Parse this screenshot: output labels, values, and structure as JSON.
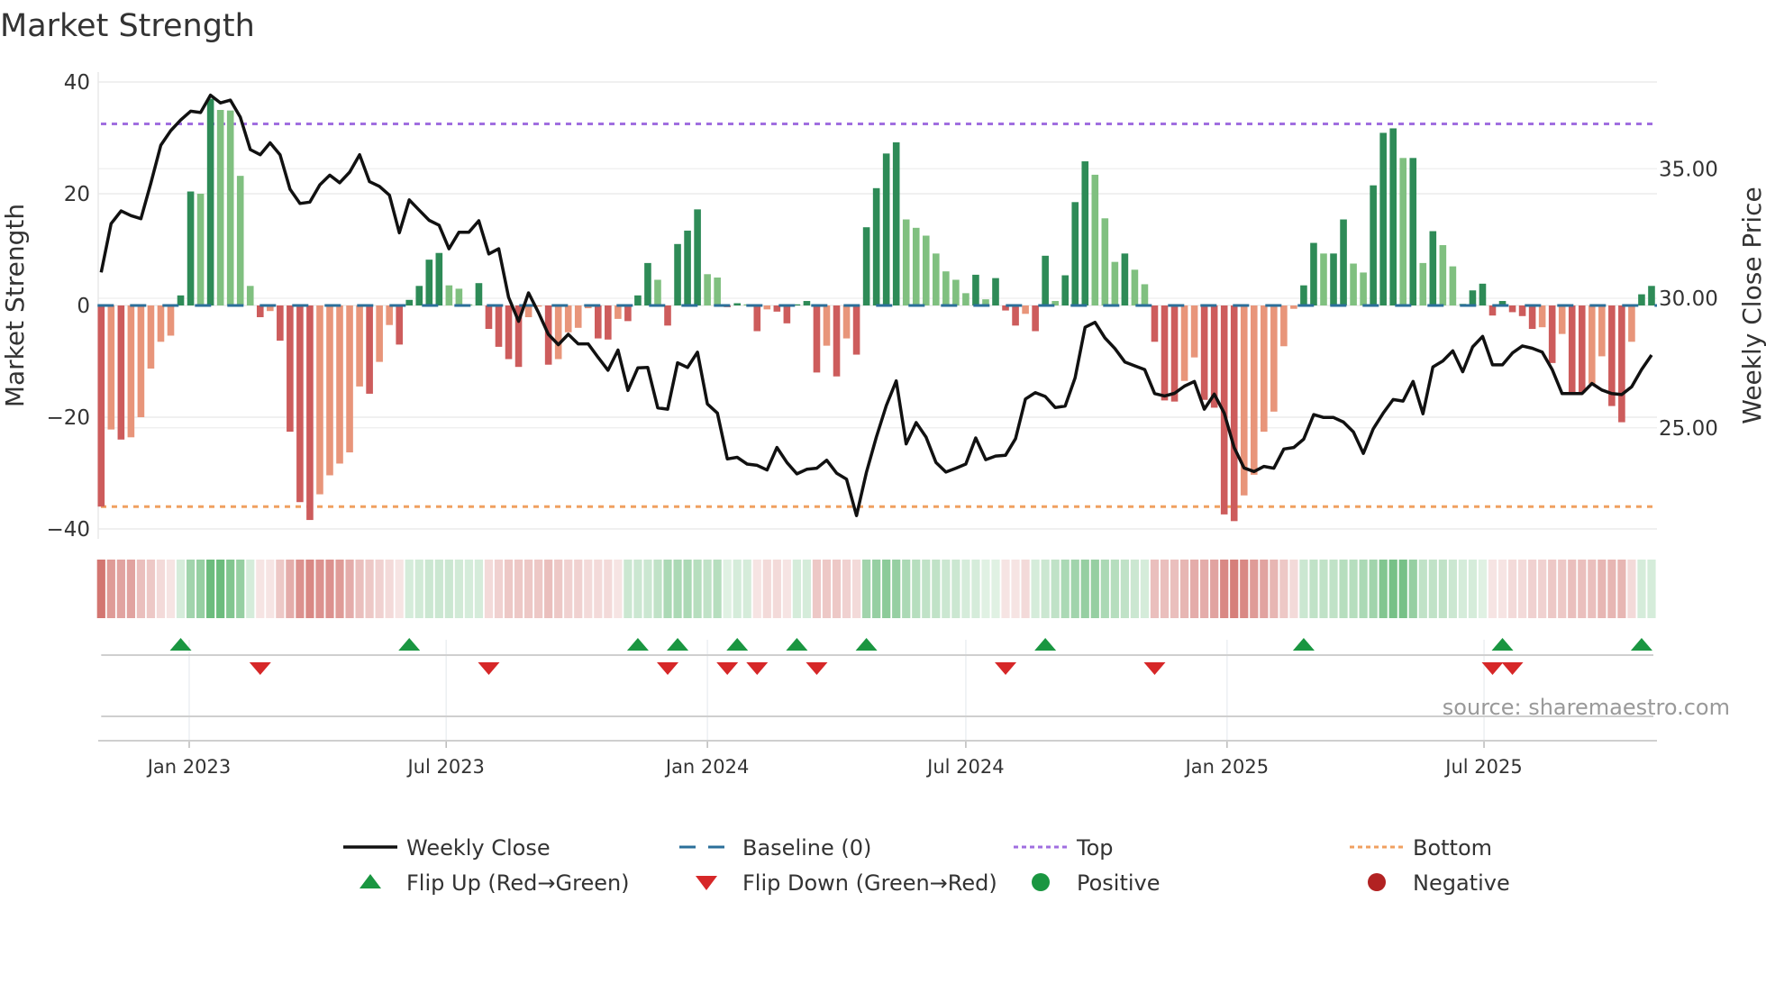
{
  "chart_data": {
    "type": "bar",
    "title": "Market Strength",
    "ylabel": "Market Strength",
    "ylabel_right": "Weekly Close Price",
    "source": "source: sharemaestro.com",
    "ylim": [
      -40,
      40
    ],
    "yticks": [
      {
        "v": 40,
        "label": "40"
      },
      {
        "v": 20,
        "label": "20"
      },
      {
        "v": 0,
        "label": "0"
      },
      {
        "v": -20,
        "label": "−20"
      },
      {
        "v": -40,
        "label": "−40"
      }
    ],
    "ylim_right": [
      21.0,
      38.6
    ],
    "yticks_right": [
      {
        "v": 35,
        "label": "35.00"
      },
      {
        "v": 30,
        "label": "30.00"
      },
      {
        "v": 25,
        "label": "25.00"
      }
    ],
    "x_start_date": "2022-10-31",
    "x_frequency": "weekly",
    "xticks": [
      {
        "date": "2023-01-01",
        "label": "Jan 2023"
      },
      {
        "date": "2023-07-01",
        "label": "Jul 2023"
      },
      {
        "date": "2024-01-01",
        "label": "Jan 2024"
      },
      {
        "date": "2024-07-01",
        "label": "Jul 2024"
      },
      {
        "date": "2025-01-01",
        "label": "Jan 2025"
      },
      {
        "date": "2025-07-01",
        "label": "Jul 2025"
      }
    ],
    "top_level": 32.5,
    "bottom_level": -36,
    "baseline": 0,
    "strength": [
      -36,
      -22.2,
      -24,
      -23.6,
      -20,
      -11.3,
      -6.5,
      -5.4,
      1.8,
      20.4,
      20,
      37,
      35,
      34.9,
      23.2,
      3.5,
      -2.1,
      -1,
      -6.3,
      -22.6,
      -35.2,
      -38.4,
      -33.8,
      -30.4,
      -28.3,
      -26.3,
      -14.5,
      -15.8,
      -10.1,
      -3.5,
      -7,
      1,
      3.5,
      8.2,
      9.4,
      3.6,
      3,
      0.2,
      4,
      -4.2,
      -7.4,
      -9.6,
      -11,
      -2.1,
      -0.2,
      -10.6,
      -9.6,
      -4.8,
      -4,
      -0.5,
      -5.9,
      -6.1,
      -2.4,
      -2.8,
      1.8,
      7.6,
      4.6,
      -3.6,
      11,
      13.4,
      17.2,
      5.6,
      5,
      -0.3,
      0.4,
      0.2,
      -4.6,
      -0.7,
      -1.1,
      -3.2,
      0.2,
      0.8,
      -12,
      -7.2,
      -12.7,
      -5.9,
      -8.8,
      14,
      21,
      27.2,
      29.2,
      15.4,
      13.9,
      12.5,
      9.3,
      6.1,
      4.6,
      2.2,
      5.5,
      1.1,
      4.9,
      -0.9,
      -3.6,
      -1.5,
      -4.6,
      8.9,
      0.8,
      5.4,
      18.5,
      25.8,
      23.4,
      15.6,
      7.8,
      9.3,
      6.4,
      3.8,
      -6.5,
      -17,
      -17.2,
      -13.5,
      -9.3,
      -16.9,
      -18.3,
      -37.4,
      -38.6,
      -34,
      -30.3,
      -22.6,
      -19,
      -7.3,
      -0.6,
      3.6,
      11.2,
      9.3,
      9.3,
      15.4,
      7.5,
      5.9,
      21.5,
      30.9,
      31.7,
      26.4,
      26.4,
      7.6,
      13.3,
      10.8,
      7,
      0.3,
      2.7,
      3.9,
      -1.8,
      0.8,
      -1.2,
      -1.9,
      -4.2,
      -3.9,
      -10.3,
      -5.1,
      -15.6,
      -15.6,
      -14,
      -9.1,
      -18,
      -20.9,
      -6.5,
      2,
      3.5
    ],
    "weekly_close": [
      31.0,
      32.88,
      33.37,
      33.19,
      33.07,
      34.44,
      35.91,
      36.47,
      36.88,
      37.22,
      37.17,
      37.84,
      37.54,
      37.65,
      36.99,
      35.74,
      35.54,
      36.0,
      35.54,
      34.21,
      33.66,
      33.71,
      34.38,
      34.75,
      34.46,
      34.87,
      35.54,
      34.5,
      34.32,
      33.98,
      32.53,
      33.8,
      33.4,
      33.01,
      32.82,
      31.91,
      32.55,
      32.55,
      32.99,
      31.71,
      31.91,
      30.03,
      29.11,
      30.21,
      29.45,
      28.61,
      28.21,
      28.61,
      28.24,
      28.24,
      27.72,
      27.22,
      28.0,
      26.44,
      27.31,
      27.33,
      25.77,
      25.72,
      27.51,
      27.33,
      27.92,
      25.92,
      25.57,
      23.8,
      23.86,
      23.6,
      23.55,
      23.37,
      24.24,
      23.66,
      23.22,
      23.4,
      23.44,
      23.75,
      23.25,
      23.02,
      21.61,
      23.28,
      24.64,
      25.86,
      26.81,
      24.38,
      25.2,
      24.64,
      23.66,
      23.29,
      23.44,
      23.6,
      24.61,
      23.77,
      23.91,
      23.94,
      24.58,
      26.11,
      26.36,
      26.21,
      25.78,
      25.84,
      26.93,
      28.88,
      29.07,
      28.47,
      28.06,
      27.54,
      27.39,
      27.25,
      26.32,
      26.23,
      26.33,
      26.61,
      26.79,
      25.72,
      26.3,
      25.57,
      24.24,
      23.45,
      23.31,
      23.51,
      23.44,
      24.18,
      24.24,
      24.56,
      25.51,
      25.4,
      25.4,
      25.22,
      24.84,
      24.01,
      24.96,
      25.57,
      26.09,
      26.03,
      26.79,
      25.54,
      27.35,
      27.58,
      27.97,
      27.16,
      28.12,
      28.53,
      27.43,
      27.43,
      27.89,
      28.16,
      28.07,
      27.92,
      27.25,
      26.32,
      26.32,
      26.32,
      26.71,
      26.46,
      26.32,
      26.28,
      26.58,
      27.25,
      27.81
    ],
    "regime_strip": [
      -0.75,
      -0.55,
      -0.5,
      -0.5,
      -0.35,
      -0.3,
      -0.2,
      -0.15,
      0.2,
      0.45,
      0.5,
      0.7,
      0.7,
      0.6,
      0.5,
      0.2,
      -0.15,
      -0.15,
      -0.3,
      -0.45,
      -0.6,
      -0.65,
      -0.6,
      -0.6,
      -0.55,
      -0.45,
      -0.35,
      -0.3,
      -0.25,
      -0.2,
      -0.15,
      0.2,
      0.22,
      0.25,
      0.25,
      0.25,
      0.22,
      0.2,
      0.2,
      -0.2,
      -0.25,
      -0.3,
      -0.3,
      -0.3,
      -0.3,
      -0.35,
      -0.3,
      -0.25,
      -0.25,
      -0.2,
      -0.2,
      -0.2,
      -0.15,
      0.25,
      0.25,
      0.25,
      0.3,
      0.4,
      0.4,
      0.4,
      0.35,
      0.3,
      0.35,
      0.15,
      0.2,
      0.2,
      -0.15,
      -0.2,
      -0.2,
      -0.15,
      0.2,
      0.2,
      -0.3,
      -0.3,
      -0.3,
      -0.25,
      -0.2,
      0.45,
      0.5,
      0.55,
      0.5,
      0.4,
      0.35,
      0.3,
      0.3,
      0.25,
      0.25,
      0.2,
      0.2,
      0.15,
      0.15,
      -0.15,
      -0.15,
      -0.2,
      0.2,
      0.25,
      0.3,
      0.4,
      0.45,
      0.5,
      0.5,
      0.4,
      0.35,
      0.3,
      0.25,
      0.2,
      -0.35,
      -0.35,
      -0.35,
      -0.4,
      -0.45,
      -0.45,
      -0.5,
      -0.65,
      -0.7,
      -0.65,
      -0.55,
      -0.5,
      -0.4,
      -0.3,
      -0.2,
      0.25,
      0.3,
      0.3,
      0.3,
      0.35,
      0.35,
      0.4,
      0.45,
      0.6,
      0.65,
      0.65,
      0.5,
      0.3,
      0.3,
      0.3,
      0.25,
      0.2,
      0.2,
      0.15,
      -0.15,
      -0.15,
      -0.2,
      -0.2,
      -0.25,
      -0.25,
      -0.3,
      -0.3,
      -0.35,
      -0.35,
      -0.35,
      -0.4,
      -0.4,
      -0.4,
      -0.2,
      0.2,
      0.2
    ],
    "flip_up_weeks": [
      9,
      32,
      55,
      59,
      65,
      71,
      78,
      96,
      122,
      142,
      156
    ],
    "flip_down_weeks": [
      17,
      40,
      58,
      64,
      67,
      73,
      92,
      107,
      141,
      143
    ],
    "colors": {
      "pos_rising": "#2e8b57",
      "pos_falling": "#80c080",
      "neg_falling": "#cd5c5c",
      "neg_rising": "#e8957a",
      "line": "#111111",
      "baseline": "#2b6f9a",
      "top": "#a06ee0",
      "bottom": "#f0a060",
      "flip_up": "#1a9641",
      "flip_down": "#d62728",
      "positive": "#1a9641",
      "negative": "#b22222"
    },
    "legend": {
      "placement": "bottom",
      "items": [
        {
          "label": "Weekly Close",
          "kind": "line"
        },
        {
          "label": "Baseline (0)",
          "kind": "baseline"
        },
        {
          "label": "Top",
          "kind": "top"
        },
        {
          "label": "Bottom",
          "kind": "bottom"
        },
        {
          "label": "Flip Up (Red→Green)",
          "kind": "up"
        },
        {
          "label": "Flip Down (Green→Red)",
          "kind": "down"
        },
        {
          "label": "Positive",
          "kind": "pos"
        },
        {
          "label": "Negative",
          "kind": "neg"
        }
      ]
    }
  }
}
